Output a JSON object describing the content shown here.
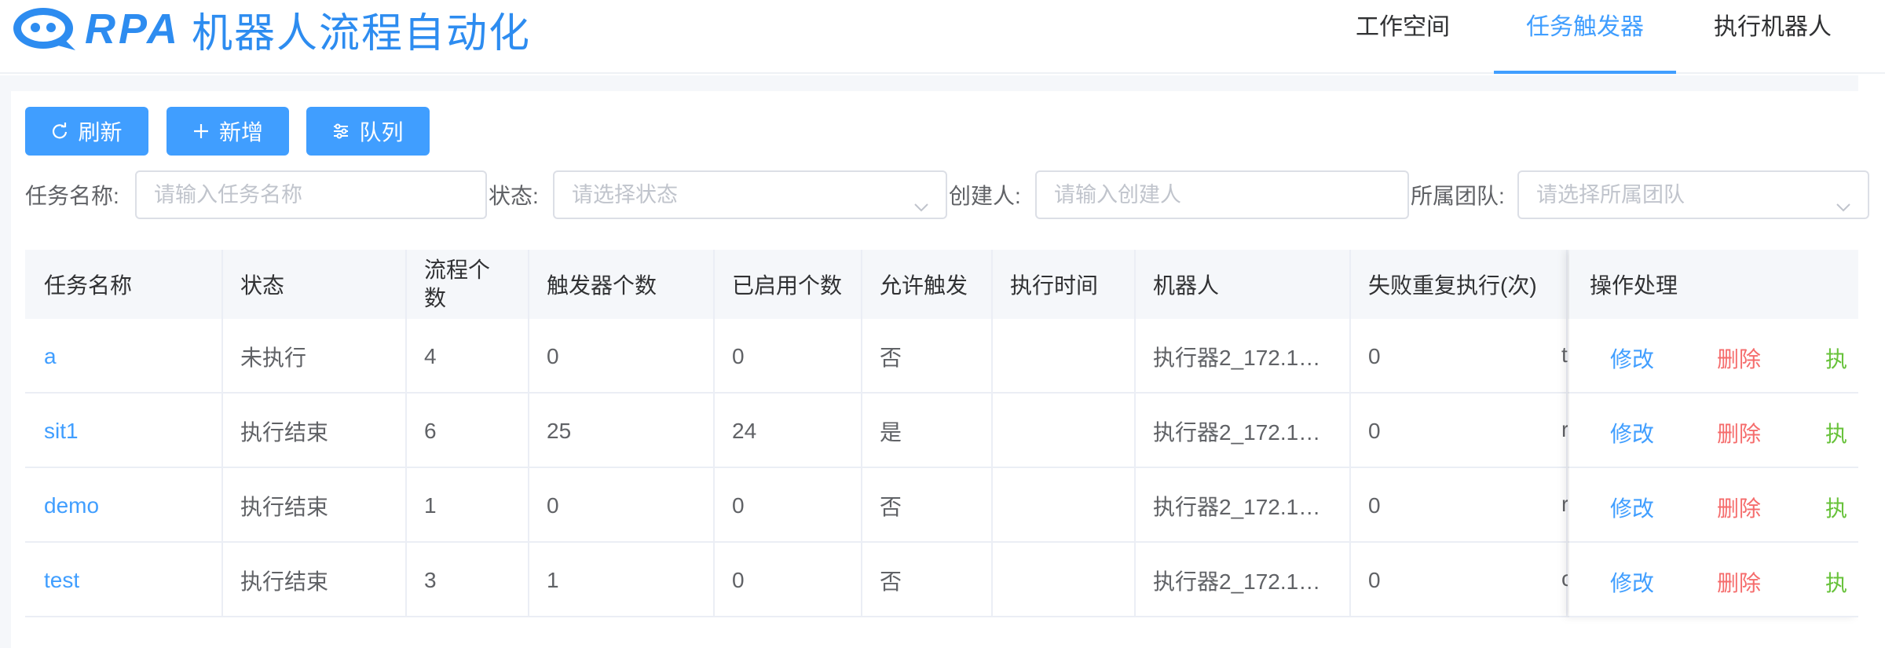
{
  "header": {
    "logo_text": "RPA",
    "title": "机器人流程自动化",
    "nav": [
      "工作空间",
      "任务触发器",
      "执行机器人"
    ],
    "active_nav": "任务触发器"
  },
  "toolbar": {
    "refresh_label": "刷新",
    "add_label": "新增",
    "queue_label": "队列"
  },
  "filters": {
    "task_name_label": "任务名称:",
    "task_name_placeholder": "请输入任务名称",
    "status_label": "状态:",
    "status_placeholder": "请选择状态",
    "creator_label": "创建人:",
    "creator_placeholder": "请输入创建人",
    "team_label": "所属团队:",
    "team_placeholder": "请选择所属团队"
  },
  "table": {
    "columns": [
      "任务名称",
      "状态",
      "流程个数",
      "触发器个数",
      "已启用个数",
      "允许触发",
      "执行时间",
      "机器人",
      "失败重复执行(次)",
      "操作处理"
    ],
    "actions": {
      "edit": "修改",
      "delete": "删除",
      "run": "执"
    },
    "rows": [
      {
        "name": "a",
        "status": "未执行",
        "flows": "4",
        "triggers": "0",
        "enabled": "0",
        "allow": "否",
        "time": "",
        "robot": "执行器2_172.1…",
        "retry": "0",
        "peek": "t"
      },
      {
        "name": "sit1",
        "status": "执行结束",
        "flows": "6",
        "triggers": "25",
        "enabled": "24",
        "allow": "是",
        "time": "",
        "robot": "执行器2_172.1…",
        "retry": "0",
        "peek": "r"
      },
      {
        "name": "demo",
        "status": "执行结束",
        "flows": "1",
        "triggers": "0",
        "enabled": "0",
        "allow": "否",
        "time": "",
        "robot": "执行器2_172.1…",
        "retry": "0",
        "peek": "r"
      },
      {
        "name": "test",
        "status": "执行结束",
        "flows": "3",
        "triggers": "1",
        "enabled": "0",
        "allow": "否",
        "time": "",
        "robot": "执行器2_172.1…",
        "retry": "0",
        "peek": "c"
      }
    ]
  },
  "colors": {
    "primary": "#409eff",
    "danger": "#f56c6c",
    "success": "#67c23a"
  }
}
